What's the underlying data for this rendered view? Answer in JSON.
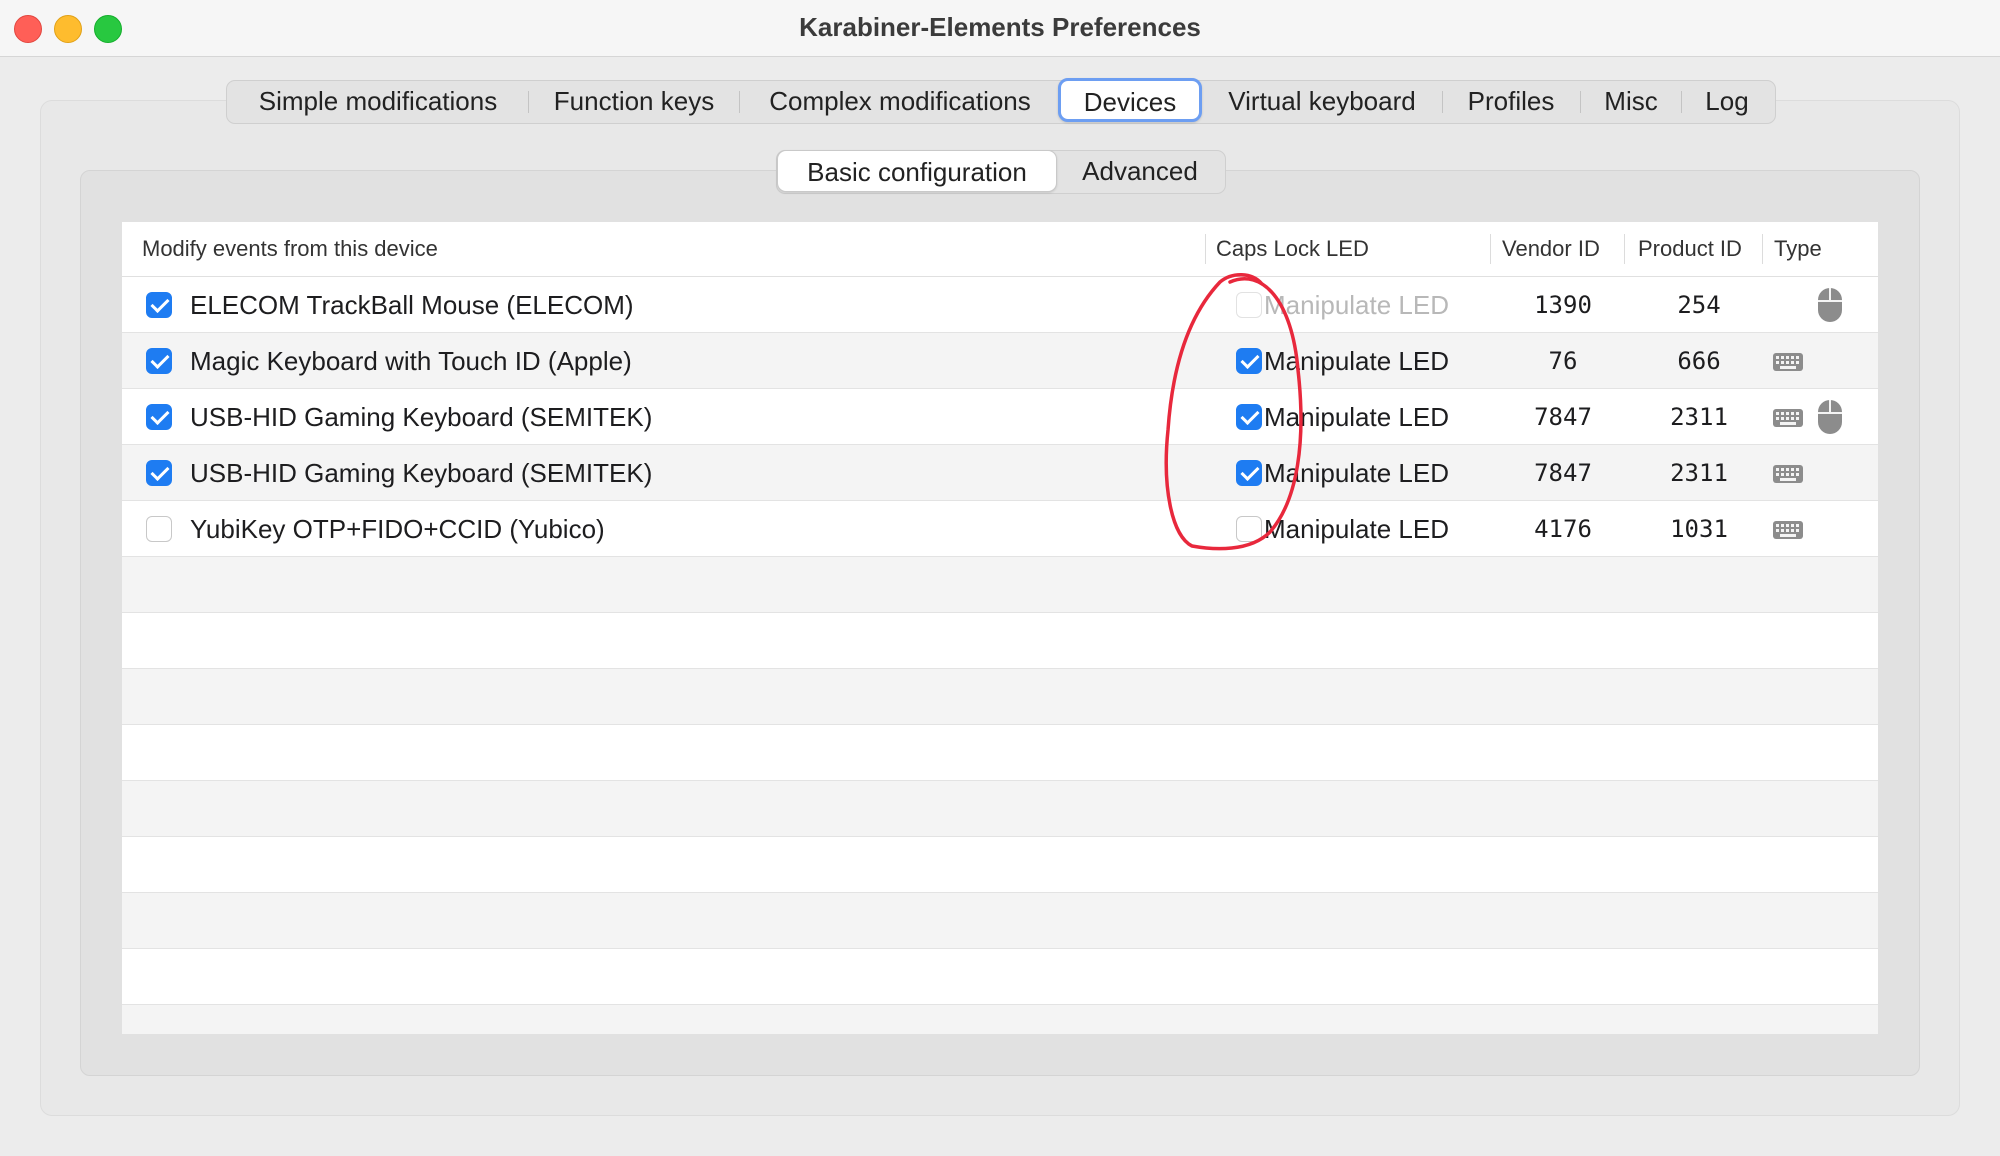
{
  "window": {
    "title": "Karabiner-Elements Preferences"
  },
  "tabs": [
    {
      "label": "Simple modifications"
    },
    {
      "label": "Function keys"
    },
    {
      "label": "Complex modifications"
    },
    {
      "label": "Devices",
      "active": true
    },
    {
      "label": "Virtual keyboard"
    },
    {
      "label": "Profiles"
    },
    {
      "label": "Misc"
    },
    {
      "label": "Log"
    }
  ],
  "subtabs": [
    {
      "label": "Basic configuration",
      "active": true
    },
    {
      "label": "Advanced"
    }
  ],
  "table": {
    "headers": {
      "device": "Modify events from this device",
      "caps_lock": "Caps Lock LED",
      "vendor_id": "Vendor ID",
      "product_id": "Product ID",
      "type": "Type"
    },
    "rows": [
      {
        "checked": true,
        "name": "ELECOM TrackBall Mouse (ELECOM)",
        "led_label": "Manipulate LED",
        "led_checked": false,
        "led_enabled": false,
        "vendor_id": "1390",
        "product_id": "254",
        "types": [
          "mouse-icon"
        ]
      },
      {
        "checked": true,
        "name": "Magic Keyboard with Touch ID (Apple)",
        "led_label": "Manipulate LED",
        "led_checked": true,
        "led_enabled": true,
        "vendor_id": "76",
        "product_id": "666",
        "types": [
          "keyboard-icon"
        ]
      },
      {
        "checked": true,
        "name": "USB-HID Gaming Keyboard (SEMITEK)",
        "led_label": "Manipulate LED",
        "led_checked": true,
        "led_enabled": true,
        "vendor_id": "7847",
        "product_id": "2311",
        "types": [
          "keyboard-icon",
          "mouse-icon"
        ]
      },
      {
        "checked": true,
        "name": "USB-HID Gaming Keyboard (SEMITEK)",
        "led_label": "Manipulate LED",
        "led_checked": true,
        "led_enabled": true,
        "vendor_id": "7847",
        "product_id": "2311",
        "types": [
          "keyboard-icon"
        ]
      },
      {
        "checked": false,
        "name": "YubiKey OTP+FIDO+CCID (Yubico)",
        "led_label": "Manipulate LED",
        "led_checked": false,
        "led_enabled": true,
        "vendor_id": "4176",
        "product_id": "1031",
        "types": [
          "keyboard-icon"
        ]
      }
    ]
  },
  "colors": {
    "accent": "#1e7cf2",
    "annotation": "#e8283c"
  }
}
